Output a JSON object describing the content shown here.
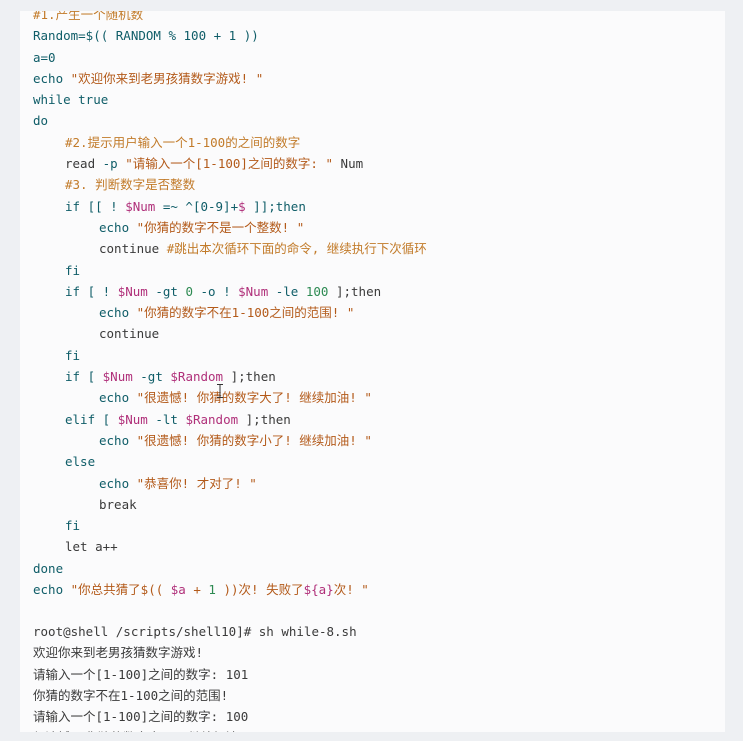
{
  "script_lines": [
    {
      "indent": 0,
      "tokens": [
        {
          "t": "#1.产生一个随机数",
          "c": "cm"
        }
      ]
    },
    {
      "indent": 0,
      "tokens": [
        {
          "t": "Random=$(( RANDOM % 100 + 1 ))",
          "c": "kw"
        }
      ]
    },
    {
      "indent": 0,
      "tokens": [
        {
          "t": "a=0",
          "c": "kw"
        }
      ]
    },
    {
      "indent": 0,
      "tokens": [
        {
          "t": "echo ",
          "c": "kw"
        },
        {
          "t": "\"欢迎你来到老男孩猜数字游戏! \"",
          "c": "str"
        }
      ]
    },
    {
      "indent": 0,
      "tokens": [
        {
          "t": "while true",
          "c": "kw"
        }
      ]
    },
    {
      "indent": 0,
      "tokens": [
        {
          "t": "do",
          "c": "kw"
        }
      ]
    },
    {
      "indent": 1,
      "tokens": [
        {
          "t": "#2.提示用户输入一个1-100的之间的数字",
          "c": "cm"
        }
      ]
    },
    {
      "indent": 1,
      "tokens": [
        {
          "t": "read ",
          "c": "out"
        },
        {
          "t": "-p ",
          "c": "kw"
        },
        {
          "t": "\"请输入一个[1-100]之间的数字: \"",
          "c": "str"
        },
        {
          "t": " Num",
          "c": "out"
        }
      ]
    },
    {
      "indent": 1,
      "tokens": [
        {
          "t": "#3. 判断数字是否整数",
          "c": "cm"
        }
      ]
    },
    {
      "indent": 1,
      "tokens": [
        {
          "t": "if [[ ! ",
          "c": "kw"
        },
        {
          "t": "$Num",
          "c": "var"
        },
        {
          "t": " =~ ^[0-9]+",
          "c": "kw"
        },
        {
          "t": "$",
          "c": "var"
        },
        {
          "t": " ]];then",
          "c": "kw"
        }
      ]
    },
    {
      "indent": 2,
      "tokens": [
        {
          "t": "echo ",
          "c": "kw"
        },
        {
          "t": "\"你猜的数字不是一个整数! \"",
          "c": "str"
        }
      ]
    },
    {
      "indent": 2,
      "tokens": [
        {
          "t": "continue ",
          "c": "out"
        },
        {
          "t": "#跳出本次循环下面的命令, 继续执行下次循环",
          "c": "cm"
        }
      ]
    },
    {
      "indent": 1,
      "tokens": [
        {
          "t": "fi",
          "c": "kw"
        }
      ]
    },
    {
      "indent": 1,
      "tokens": [
        {
          "t": "if [ ! ",
          "c": "kw"
        },
        {
          "t": "$Num",
          "c": "var"
        },
        {
          "t": " -gt ",
          "c": "kw"
        },
        {
          "t": "0",
          "c": "num"
        },
        {
          "t": " -o ! ",
          "c": "kw"
        },
        {
          "t": "$Num",
          "c": "var"
        },
        {
          "t": " -le ",
          "c": "kw"
        },
        {
          "t": "100",
          "c": "num"
        },
        {
          "t": " ];then",
          "c": "out"
        }
      ]
    },
    {
      "indent": 2,
      "tokens": [
        {
          "t": "echo ",
          "c": "kw"
        },
        {
          "t": "\"你猜的数字不在1-100之间的范围! \"",
          "c": "str"
        }
      ]
    },
    {
      "indent": 2,
      "tokens": [
        {
          "t": "continue",
          "c": "out"
        }
      ]
    },
    {
      "indent": 1,
      "tokens": [
        {
          "t": "fi",
          "c": "kw"
        }
      ]
    },
    {
      "indent": 1,
      "tokens": [
        {
          "t": "if [ ",
          "c": "kw"
        },
        {
          "t": "$Num",
          "c": "var"
        },
        {
          "t": " -gt ",
          "c": "kw"
        },
        {
          "t": "$Random",
          "c": "var"
        },
        {
          "t": " ];then",
          "c": "out"
        }
      ]
    },
    {
      "indent": 2,
      "tokens": [
        {
          "t": "echo ",
          "c": "kw"
        },
        {
          "t": "\"很遗憾! 你猜的数字大了! 继续加油! \"",
          "c": "str"
        }
      ]
    },
    {
      "indent": 1,
      "tokens": [
        {
          "t": "elif [ ",
          "c": "kw"
        },
        {
          "t": "$Num",
          "c": "var"
        },
        {
          "t": " -lt ",
          "c": "kw"
        },
        {
          "t": "$Random",
          "c": "var"
        },
        {
          "t": " ];then",
          "c": "out"
        }
      ]
    },
    {
      "indent": 2,
      "tokens": [
        {
          "t": "echo ",
          "c": "kw"
        },
        {
          "t": "\"很遗憾! 你猜的数字小了! 继续加油! \"",
          "c": "str"
        }
      ]
    },
    {
      "indent": 1,
      "tokens": [
        {
          "t": "else",
          "c": "kw"
        }
      ]
    },
    {
      "indent": 2,
      "tokens": [
        {
          "t": "echo ",
          "c": "kw"
        },
        {
          "t": "\"恭喜你! 才对了! \"",
          "c": "str"
        }
      ]
    },
    {
      "indent": 2,
      "tokens": [
        {
          "t": "break",
          "c": "out"
        }
      ]
    },
    {
      "indent": 1,
      "tokens": [
        {
          "t": "fi",
          "c": "kw"
        }
      ]
    },
    {
      "indent": 1,
      "tokens": [
        {
          "t": "let a++",
          "c": "out"
        }
      ]
    },
    {
      "indent": 0,
      "tokens": [
        {
          "t": "done",
          "c": "kw"
        }
      ]
    },
    {
      "indent": 0,
      "tokens": [
        {
          "t": "echo ",
          "c": "kw"
        },
        {
          "t": "\"你总共猜了$(( ",
          "c": "str"
        },
        {
          "t": "$a",
          "c": "var"
        },
        {
          "t": " + ",
          "c": "str"
        },
        {
          "t": "1",
          "c": "num"
        },
        {
          "t": " ))次! 失败了",
          "c": "str"
        },
        {
          "t": "${a}",
          "c": "var"
        },
        {
          "t": "次! \"",
          "c": "str"
        }
      ]
    }
  ],
  "terminal_lines": [
    "root@shell /scripts/shell10]# sh while-8.sh",
    "欢迎你来到老男孩猜数字游戏!",
    "请输入一个[1-100]之间的数字: 101",
    "你猜的数字不在1-100之间的范围!",
    "请输入一个[1-100]之间的数字: 100",
    "很遗憾! 你猜的数字大了! 继续加油!"
  ],
  "colors": {
    "keyword": "#0f5d68",
    "variable": "#b0307a",
    "number": "#2d8a52",
    "string": "#b35a1a",
    "comment": "#c27b2a",
    "plain": "#3a3a3a"
  },
  "cursor_icon": "text-cursor-icon"
}
